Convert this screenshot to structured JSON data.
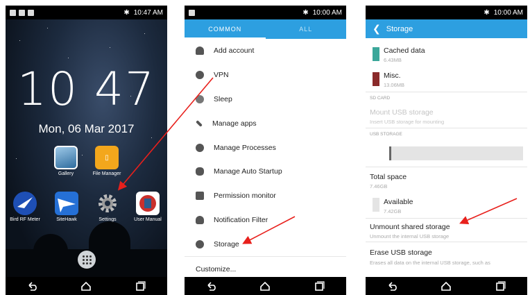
{
  "colors": {
    "accent": "#2d9fe0",
    "arrow": "#e8201c",
    "cached_swatch": "#3ba79a",
    "misc_swatch": "#8a2a2a"
  },
  "home": {
    "status_time": "10:47 AM",
    "clock": "10 47",
    "date": "Mon, 06 Mar 2017",
    "apps_row1": [
      {
        "label": "Gallery",
        "icon": "gallery-icon"
      },
      {
        "label": "File Manager",
        "icon": "file-manager-icon"
      }
    ],
    "apps_row2": [
      {
        "label": "Bird RF Meter",
        "icon": "bird-rf-meter-icon"
      },
      {
        "label": "SiteHawk",
        "icon": "sitehawk-icon"
      },
      {
        "label": "Settings",
        "icon": "settings-gear-icon"
      },
      {
        "label": "User Manual",
        "icon": "user-manual-icon"
      }
    ]
  },
  "settings": {
    "status_time": "10:00 AM",
    "tabs": [
      "COMMON",
      "ALL"
    ],
    "items": [
      {
        "label": "Add account",
        "icon": "add-account-icon"
      },
      {
        "label": "VPN",
        "icon": "vpn-icon"
      },
      {
        "label": "Sleep",
        "icon": "sleep-icon"
      },
      {
        "label": "Manage apps",
        "icon": "manage-apps-icon"
      },
      {
        "label": "Manage Processes",
        "icon": "processes-icon"
      },
      {
        "label": "Manage Auto Startup",
        "icon": "auto-startup-icon"
      },
      {
        "label": "Permission monitor",
        "icon": "permission-icon"
      },
      {
        "label": "Notification Filter",
        "icon": "notification-filter-icon"
      },
      {
        "label": "Storage",
        "icon": "storage-icon"
      },
      {
        "label": "Customize...",
        "icon": ""
      }
    ]
  },
  "storage": {
    "status_time": "10:00 AM",
    "title": "Storage",
    "cached_title": "Cached data",
    "cached_size": "6.43MB",
    "misc_title": "Misc.",
    "misc_size": "13.06MB",
    "sd_header": "SD CARD",
    "mount_title": "Mount USB storage",
    "mount_sub": "Insert USB storage for mounting",
    "usb_header": "USB STORAGE",
    "total_title": "Total space",
    "total_size": "7.46GB",
    "avail_title": "Available",
    "avail_size": "7.42GB",
    "unmount_title": "Unmount shared storage",
    "unmount_sub": "Unmount the internal USB storage",
    "erase_title": "Erase USB storage",
    "erase_sub": "Erases all data on the internal USB storage, such as"
  }
}
